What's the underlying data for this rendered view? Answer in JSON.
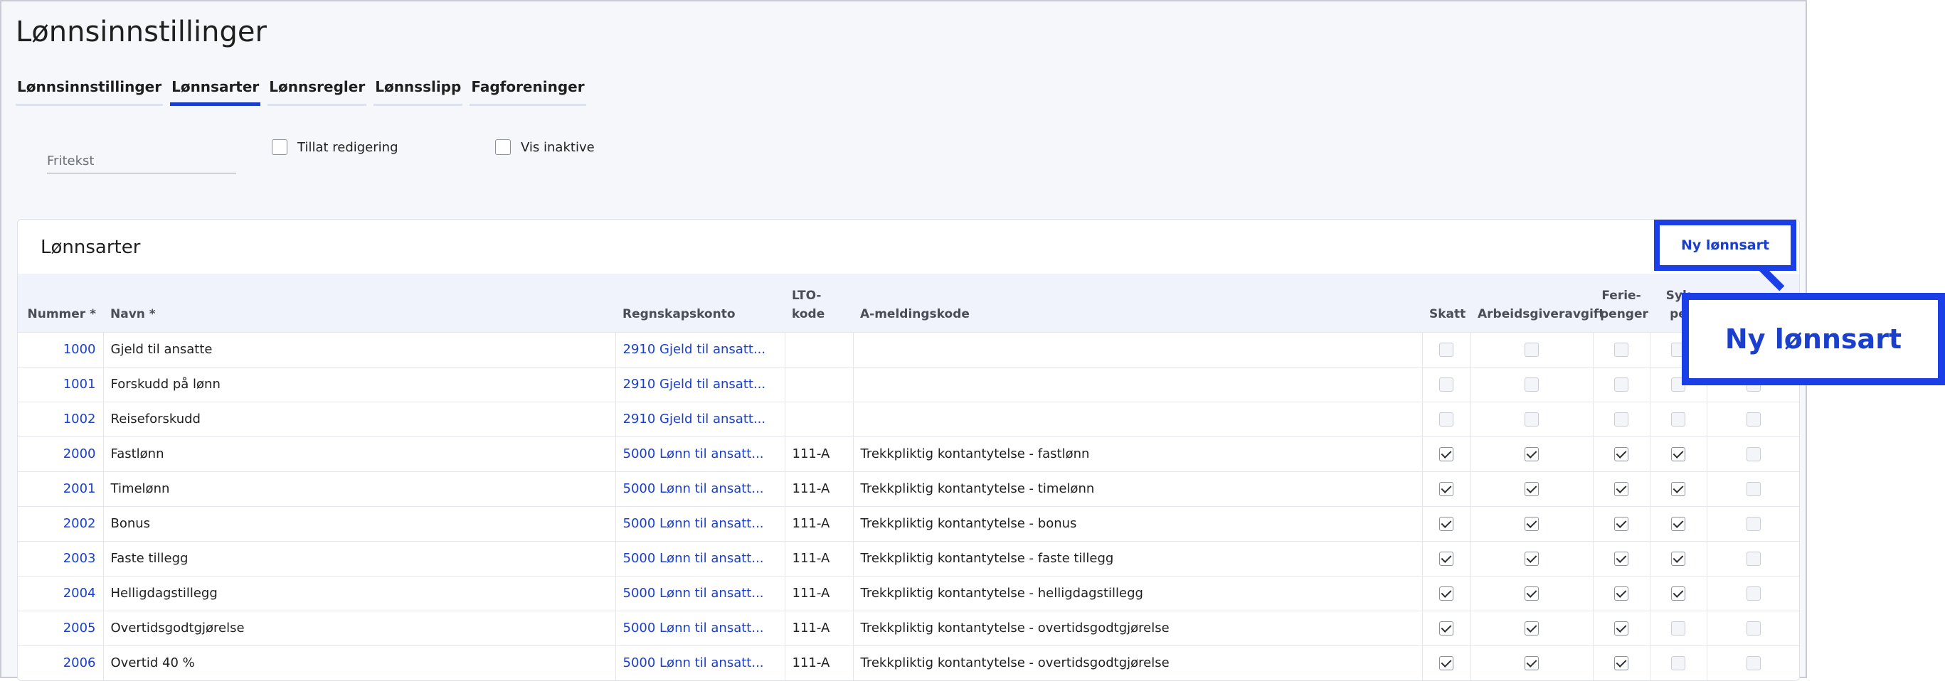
{
  "page": {
    "title": "Lønnsinnstillinger"
  },
  "tabs": [
    {
      "label": "Lønnsinnstillinger",
      "active": false
    },
    {
      "label": "Lønnsarter",
      "active": true
    },
    {
      "label": "Lønnsregler",
      "active": false
    },
    {
      "label": "Lønnsslipp",
      "active": false
    },
    {
      "label": "Fagforeninger",
      "active": false
    }
  ],
  "filters": {
    "search_placeholder": "Fritekst",
    "search_value": "",
    "allow_edit_label": "Tillat redigering",
    "allow_edit_checked": false,
    "show_inactive_label": "Vis inaktive",
    "show_inactive_checked": false
  },
  "card": {
    "title": "Lønnsarter",
    "new_button_label": "Ny lønnsart",
    "zoom_label": "Ny lønnsart"
  },
  "table": {
    "headers": {
      "nummer": "Nummer *",
      "navn": "Navn *",
      "konto": "Regnskapskonto",
      "lto_line1": "LTO-",
      "lto_line2": "kode",
      "amelding": "A-meldingskode",
      "skatt": "Skatt",
      "aga": "Arbeidsgiveravgift",
      "ferie_line1": "Ferie-",
      "ferie_line2": "penger",
      "syke_line1": "Syk",
      "syke_line2": "pe"
    },
    "rows": [
      {
        "nummer": "1000",
        "navn": "Gjeld til ansatte",
        "konto": "2910 Gjeld til ansatt...",
        "lto": "",
        "amelding": "",
        "skatt": false,
        "aga": false,
        "ferie": false,
        "syke": false,
        "extra": false
      },
      {
        "nummer": "1001",
        "navn": "Forskudd på lønn",
        "konto": "2910 Gjeld til ansatt...",
        "lto": "",
        "amelding": "",
        "skatt": false,
        "aga": false,
        "ferie": false,
        "syke": false,
        "extra": false
      },
      {
        "nummer": "1002",
        "navn": "Reiseforskudd",
        "konto": "2910 Gjeld til ansatt...",
        "lto": "",
        "amelding": "",
        "skatt": false,
        "aga": false,
        "ferie": false,
        "syke": false,
        "extra": false
      },
      {
        "nummer": "2000",
        "navn": "Fastlønn",
        "konto": "5000 Lønn til ansatt...",
        "lto": "111-A",
        "amelding": "Trekkpliktig kontantytelse - fastlønn",
        "skatt": true,
        "aga": true,
        "ferie": true,
        "syke": true,
        "extra": false
      },
      {
        "nummer": "2001",
        "navn": "Timelønn",
        "konto": "5000 Lønn til ansatt...",
        "lto": "111-A",
        "amelding": "Trekkpliktig kontantytelse - timelønn",
        "skatt": true,
        "aga": true,
        "ferie": true,
        "syke": true,
        "extra": false
      },
      {
        "nummer": "2002",
        "navn": "Bonus",
        "konto": "5000 Lønn til ansatt...",
        "lto": "111-A",
        "amelding": "Trekkpliktig kontantytelse - bonus",
        "skatt": true,
        "aga": true,
        "ferie": true,
        "syke": true,
        "extra": false
      },
      {
        "nummer": "2003",
        "navn": "Faste tillegg",
        "konto": "5000 Lønn til ansatt...",
        "lto": "111-A",
        "amelding": "Trekkpliktig kontantytelse - faste tillegg",
        "skatt": true,
        "aga": true,
        "ferie": true,
        "syke": true,
        "extra": false
      },
      {
        "nummer": "2004",
        "navn": "Helligdagstillegg",
        "konto": "5000 Lønn til ansatt...",
        "lto": "111-A",
        "amelding": "Trekkpliktig kontantytelse - helligdagstillegg",
        "skatt": true,
        "aga": true,
        "ferie": true,
        "syke": true,
        "extra": false
      },
      {
        "nummer": "2005",
        "navn": "Overtidsgodtgjørelse",
        "konto": "5000 Lønn til ansatt...",
        "lto": "111-A",
        "amelding": "Trekkpliktig kontantytelse - overtidsgodtgjørelse",
        "skatt": true,
        "aga": true,
        "ferie": true,
        "syke": false,
        "extra": false
      },
      {
        "nummer": "2006",
        "navn": "Overtid 40 %",
        "konto": "5000 Lønn til ansatt...",
        "lto": "111-A",
        "amelding": "Trekkpliktig kontantytelse - overtidsgodtgjørelse",
        "skatt": true,
        "aga": true,
        "ferie": true,
        "syke": false,
        "extra": false
      }
    ]
  },
  "colors": {
    "accent": "#1a3fcc",
    "highlight": "#1a3fe6"
  }
}
